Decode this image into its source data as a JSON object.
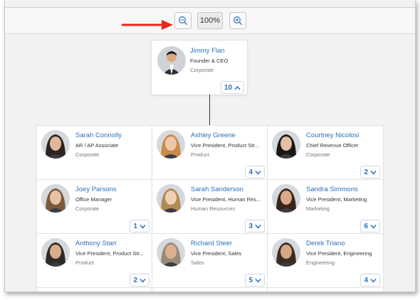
{
  "toolbar": {
    "zoom_level": "100%"
  },
  "root": {
    "name": "Jimmy Flan",
    "title": "Founder & CEO",
    "department": "Corporate",
    "count": "10",
    "expanded": true
  },
  "reports": [
    {
      "name": "Sarah Connolly",
      "title": "AR / AP Associate",
      "department": "Corporate",
      "count": ""
    },
    {
      "name": "Ashley Greene",
      "title": "Vice President, Product Str...",
      "department": "Product",
      "count": "4"
    },
    {
      "name": "Courtney Nicolosi",
      "title": "Chief Revenue Officer",
      "department": "Corporate",
      "count": "2"
    },
    {
      "name": "Joey Parsons",
      "title": "Office Manager",
      "department": "Corporate",
      "count": "1"
    },
    {
      "name": "Sarah Sanderson",
      "title": "Vice President, Human Res...",
      "department": "Human Resources",
      "count": "3"
    },
    {
      "name": "Sandra Simmons",
      "title": "Vice President, Marketing",
      "department": "Marketing",
      "count": "6"
    },
    {
      "name": "Anthony Starr",
      "title": "Vice President, Product Str...",
      "department": "Product",
      "count": "2"
    },
    {
      "name": "Richard Steer",
      "title": "Vice President, Sales",
      "department": "Sales",
      "count": "5"
    },
    {
      "name": "Derek Triano",
      "title": "Vice President, Engineering",
      "department": "Engineering",
      "count": "4"
    }
  ],
  "colors": {
    "link": "#2a6fbd",
    "arrow": "#e8261a"
  }
}
